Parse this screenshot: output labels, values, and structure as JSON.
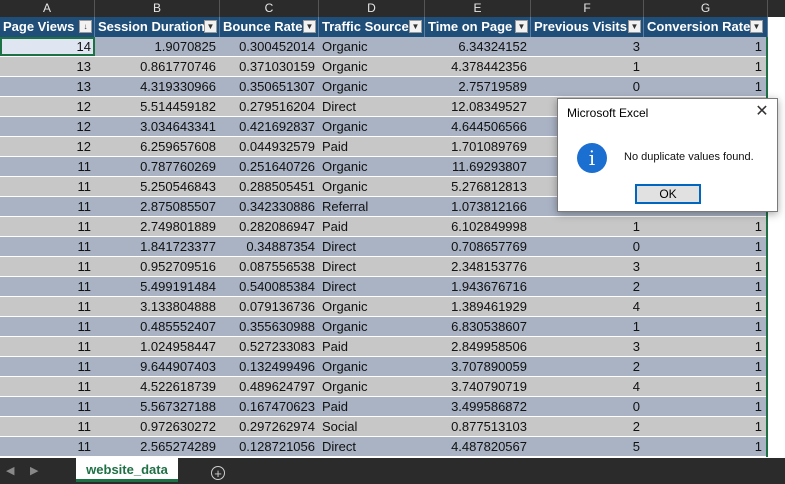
{
  "column_letters": [
    "A",
    "B",
    "C",
    "D",
    "E",
    "F",
    "G"
  ],
  "headers": [
    "Page Views",
    "Session Duration",
    "Bounce Rate",
    "Traffic Source",
    "Time on Page",
    "Previous Visits",
    "Conversion Rate"
  ],
  "sort_indicator_icon": "sort-descending-icon",
  "rows": [
    [
      "14",
      "1.9070825",
      "0.300452014",
      "Organic",
      "6.34324152",
      "3",
      "1"
    ],
    [
      "13",
      "0.861770746",
      "0.371030159",
      "Organic",
      "4.378442356",
      "1",
      "1"
    ],
    [
      "13",
      "4.319330966",
      "0.350651307",
      "Organic",
      "2.75719589",
      "0",
      "1"
    ],
    [
      "12",
      "5.514459182",
      "0.279516204",
      "Direct",
      "12.08349527",
      "",
      ""
    ],
    [
      "12",
      "3.034643341",
      "0.421692837",
      "Organic",
      "4.644506566",
      "",
      ""
    ],
    [
      "12",
      "6.259657608",
      "0.044932579",
      "Paid",
      "1.701089769",
      "",
      ""
    ],
    [
      "11",
      "0.787760269",
      "0.251640726",
      "Organic",
      "11.69293807",
      "",
      ""
    ],
    [
      "11",
      "5.250546843",
      "0.288505451",
      "Organic",
      "5.276812813",
      "",
      ""
    ],
    [
      "11",
      "2.875085507",
      "0.342330886",
      "Referral",
      "1.073812166",
      "",
      ""
    ],
    [
      "11",
      "2.749801889",
      "0.282086947",
      "Paid",
      "6.102849998",
      "1",
      "1"
    ],
    [
      "11",
      "1.841723377",
      "0.34887354",
      "Direct",
      "0.708657769",
      "0",
      "1"
    ],
    [
      "11",
      "0.952709516",
      "0.087556538",
      "Direct",
      "2.348153776",
      "3",
      "1"
    ],
    [
      "11",
      "5.499191484",
      "0.540085384",
      "Direct",
      "1.943676716",
      "2",
      "1"
    ],
    [
      "11",
      "3.133804888",
      "0.079136736",
      "Organic",
      "1.389461929",
      "4",
      "1"
    ],
    [
      "11",
      "0.485552407",
      "0.355630988",
      "Organic",
      "6.830538607",
      "1",
      "1"
    ],
    [
      "11",
      "1.024958447",
      "0.527233083",
      "Paid",
      "2.849958506",
      "3",
      "1"
    ],
    [
      "11",
      "9.644907403",
      "0.132499496",
      "Organic",
      "3.707890059",
      "2",
      "1"
    ],
    [
      "11",
      "4.522618739",
      "0.489624797",
      "Organic",
      "3.740790719",
      "4",
      "1"
    ],
    [
      "11",
      "5.567327188",
      "0.167470623",
      "Paid",
      "3.499586872",
      "0",
      "1"
    ],
    [
      "11",
      "0.972630272",
      "0.297262974",
      "Social",
      "0.877513103",
      "2",
      "1"
    ],
    [
      "11",
      "2.565274289",
      "0.128721056",
      "Direct",
      "4.487820567",
      "5",
      "1"
    ]
  ],
  "sheet_tab": "website_data",
  "dialog": {
    "title": "Microsoft Excel",
    "message": "No duplicate values found.",
    "ok_label": "OK",
    "icon": "info-icon"
  },
  "colors": {
    "header": "#1f4e79",
    "band_a": "#a9b3c4",
    "band_b": "#c7c7c7",
    "accent": "#1e7145",
    "info": "#1a6fd0"
  }
}
